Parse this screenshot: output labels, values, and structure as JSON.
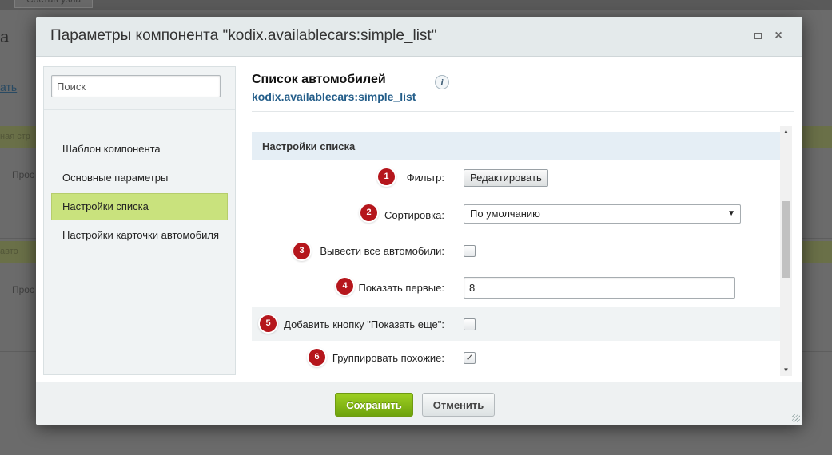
{
  "background": {
    "tab_label": "Состав узла",
    "letter": "а",
    "link_text": "ать",
    "band1_text": "ная стр",
    "text1": "Прос",
    "band2_text": "авто",
    "text2": "Прос"
  },
  "dialog": {
    "title": "Параметры компонента \"kodix.availablecars:simple_list\"",
    "maximize_icon": "maximize-icon",
    "close_icon": "×"
  },
  "sidebar": {
    "search_placeholder": "Поиск",
    "items": [
      {
        "label": "Шаблон компонента",
        "active": false
      },
      {
        "label": "Основные параметры",
        "active": false
      },
      {
        "label": "Настройки списка",
        "active": true
      },
      {
        "label": "Настройки карточки автомобиля",
        "active": false
      }
    ]
  },
  "content": {
    "title": "Список автомобилей",
    "subtitle": "kodix.availablecars:simple_list",
    "info_icon": "i",
    "section_title": "Настройки списка",
    "rows": [
      {
        "number": "1",
        "label": "Фильтр:",
        "control": "button",
        "button_label": "Редактировать"
      },
      {
        "number": "2",
        "label": "Сортировка:",
        "control": "select",
        "value": "По умолчанию"
      },
      {
        "number": "3",
        "label": "Вывести все автомобили:",
        "control": "checkbox",
        "checked": false
      },
      {
        "number": "4",
        "label": "Показать первые:",
        "control": "text",
        "value": "8"
      },
      {
        "number": "5",
        "label": "Добавить кнопку \"Показать еще\":",
        "control": "checkbox",
        "checked": false
      },
      {
        "number": "6",
        "label": "Группировать похожие:",
        "control": "checkbox",
        "checked": true,
        "check_mark": "✓"
      }
    ]
  },
  "footer": {
    "save_label": "Сохранить",
    "cancel_label": "Отменить"
  },
  "colors": {
    "badge": "#b5161c",
    "active_nav": "#c9e27d",
    "save_button": "#86bb17",
    "section_header": "#e5eef5",
    "subtitle_link": "#245e8a"
  }
}
